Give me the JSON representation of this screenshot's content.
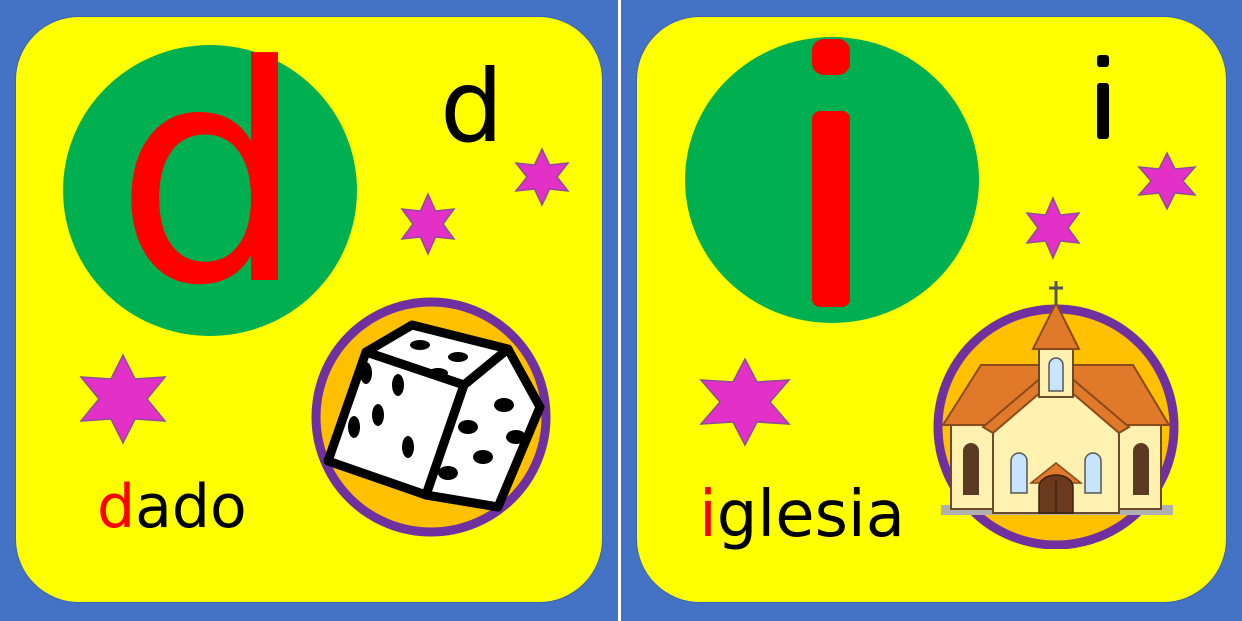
{
  "cards": [
    {
      "big_letter": "d",
      "small_letter": "d",
      "word_first": "d",
      "word_rest": "ado",
      "picture_icon": "dice-icon"
    },
    {
      "big_letter": "i",
      "small_letter": "i",
      "word_first": "i",
      "word_rest": "glesia",
      "picture_icon": "church-icon"
    }
  ],
  "colors": {
    "background": "#4472c4",
    "card": "#ffff00",
    "circle": "#00b050",
    "big_letter": "#ff0000",
    "star": "#e331c8",
    "picture_ring": "#7030a0",
    "picture_fill": "#ffc000"
  }
}
